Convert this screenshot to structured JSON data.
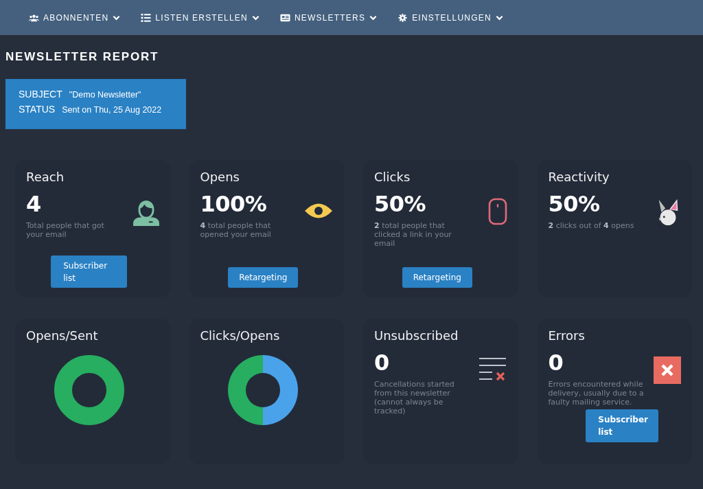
{
  "nav": [
    {
      "label": "ABONNENTEN"
    },
    {
      "label": "LISTEN ERSTELLEN"
    },
    {
      "label": "NEWSLETTERS"
    },
    {
      "label": "EINSTELLUNGEN"
    }
  ],
  "title": "NEWSLETTER REPORT",
  "info": [
    {
      "label": "SUBJECT",
      "value": "\"Demo Newsletter\""
    },
    {
      "label": "STATUS",
      "value": "Sent on Thu, 25 Aug 2022"
    }
  ],
  "stats": [
    {
      "title": "Reach",
      "value": "4",
      "description": "Total people that got your email",
      "button": "Subscriber list"
    },
    {
      "title": "Opens",
      "value": "100%",
      "description": "**4** total people that opened your email",
      "button": "Retargeting"
    },
    {
      "title": "Clicks",
      "value": "50%",
      "description": "**2** total people that clicked a link in your email",
      "button": "Retargeting"
    },
    {
      "title": "Reactivity",
      "value": "50%",
      "description": "**2** clicks out of **4** opens"
    }
  ],
  "bottom": [
    {
      "kind": "donut",
      "title": "Opens/Sent"
    },
    {
      "kind": "donut",
      "title": "Clicks/Opens"
    },
    {
      "kind": "stat",
      "title": "Unsubscribed",
      "value": "0",
      "description": "Cancellations started from this newsletter (cannot always be tracked)"
    },
    {
      "kind": "stat",
      "title": "Errors",
      "value": "0",
      "description": "Errors encountered while delivery, usually due to a faulty mailing service.",
      "button": "Subscriber list"
    }
  ]
}
